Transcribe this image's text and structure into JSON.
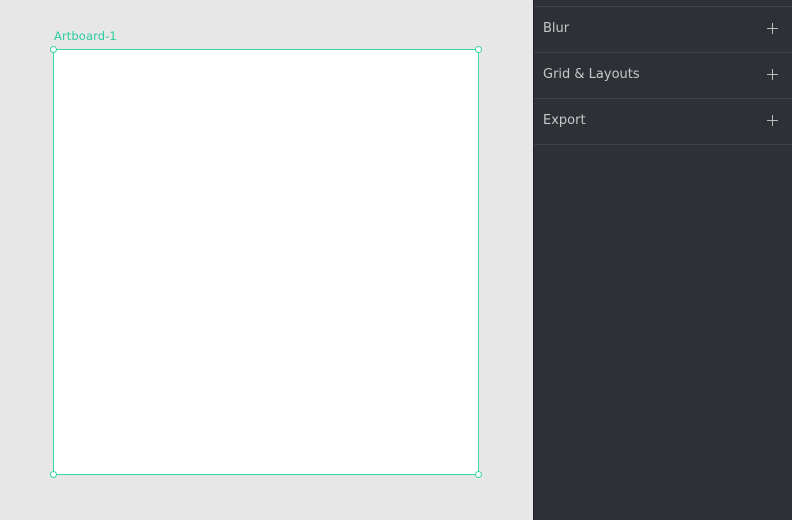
{
  "canvas": {
    "artboard": {
      "name": "Artboard-1"
    }
  },
  "inspector": {
    "sections": [
      {
        "title": "Blur",
        "action_icon": "plus-icon"
      },
      {
        "title": "Grid & Layouts",
        "action_icon": "plus-icon"
      },
      {
        "title": "Export",
        "action_icon": "plus-icon"
      }
    ]
  },
  "colors": {
    "accent": "#3ad6a8",
    "canvas_bg": "#e6e7e6",
    "panel_bg": "#2d3034"
  }
}
